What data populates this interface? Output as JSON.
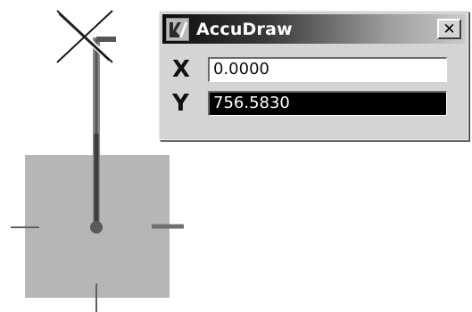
{
  "window": {
    "title": "AccuDraw",
    "close_symbol": "✕"
  },
  "fields": {
    "x": {
      "label": "X",
      "value": "0.0000"
    },
    "y": {
      "label": "Y",
      "value": "756.5830",
      "selected": true
    }
  },
  "icons": {
    "title": "accudraw-logo-icon",
    "close": "close-icon",
    "cursor": "pointer-crosshair-icon"
  },
  "colors": {
    "compass_fill": "#b6b6b6",
    "dynamic_line": "#3c3c3c",
    "selected_field": "#000000"
  }
}
